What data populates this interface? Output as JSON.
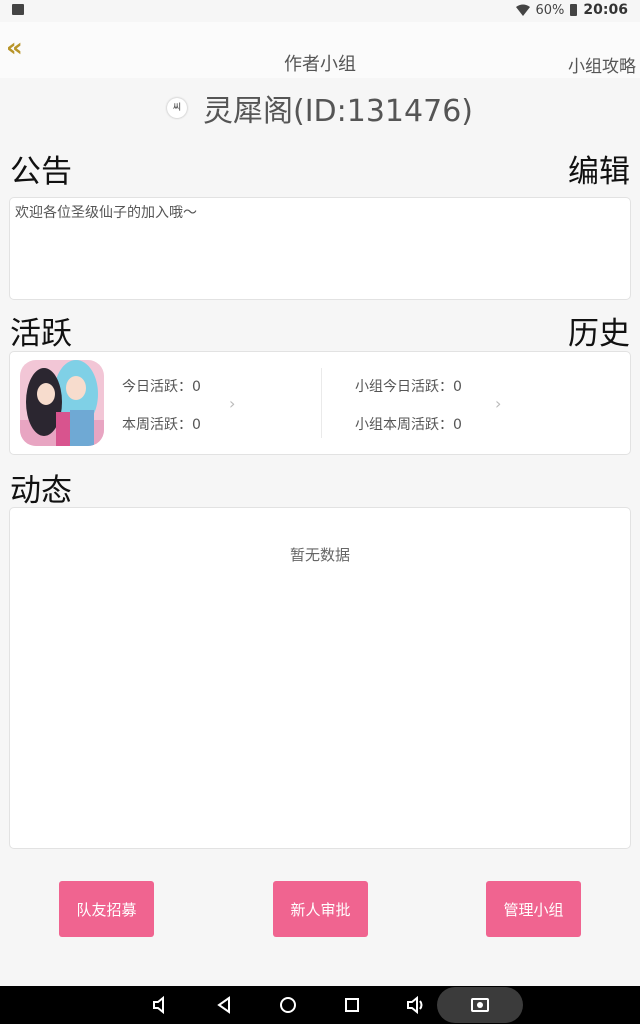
{
  "status_bar": {
    "battery": "60%",
    "time": "20:06"
  },
  "header": {
    "title": "作者小组",
    "guide_link": "小组攻略"
  },
  "group": {
    "avatar_text": "씨",
    "name": "灵犀阁(ID:131476)"
  },
  "notice": {
    "title": "公告",
    "edit_label": "编辑",
    "text": "欢迎各位圣级仙子的加入哦～"
  },
  "activity": {
    "title": "活跃",
    "history_label": "历史",
    "today": "今日活跃：0",
    "week": "本周活跃：0",
    "group_today": "小组今日活跃：0",
    "group_week": "小组本周活跃：0"
  },
  "feed": {
    "title": "动态",
    "empty_text": "暂无数据"
  },
  "actions": {
    "recruit": "队友招募",
    "approve": "新人审批",
    "manage": "管理小组"
  },
  "colors": {
    "accent": "#f06490",
    "back_icon": "#b8952a"
  }
}
